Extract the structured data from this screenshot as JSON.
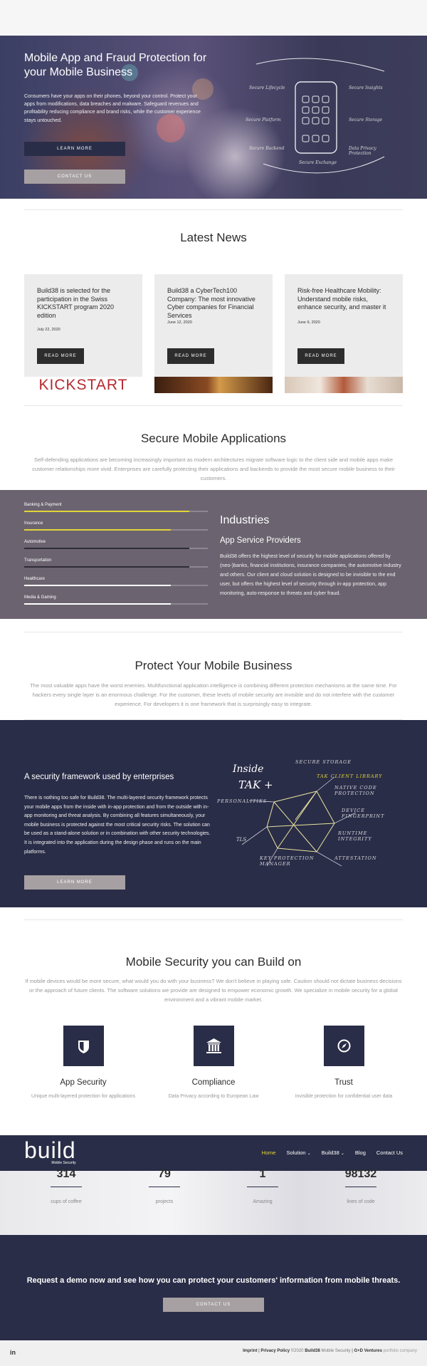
{
  "colors": {
    "navy": "#2a2d47",
    "grey_btn": "#a7a0a2",
    "purple_band": "#6b6470",
    "yellow": "#e3d43a",
    "dark_btn": "#2d2d2d"
  },
  "hero": {
    "title": "Mobile App and Fraud Protection for your Mobile Business",
    "text": "Consumers have your apps on their phones, beyond your control. Protect your apps from modifications, data breaches and malware. Safeguard revenues and profitability reducing compliance and brand risks, while the customer experience stays untouched.",
    "learn_more": "Learn More",
    "contact_us": "Contact Us",
    "sketch": [
      "Secure Lifecycle",
      "Secure Insights",
      "Secure Platform",
      "Secure Storage",
      "Secure Exchange",
      "Secure Backend",
      "Data Privacy Protection"
    ]
  },
  "news": {
    "title": "Latest News",
    "items": [
      {
        "title": "Build38 is selected for the participation in the Swiss KICKSTART program 2020 edition",
        "date": "July 22, 2020",
        "button": "Read More",
        "image_text": "KICKSTART"
      },
      {
        "title": "Build38 a CyberTech100 Company: The most innovative Cyber companies for Financial Services",
        "date": "June 12, 2020",
        "button": "Read More"
      },
      {
        "title": "Risk-free Healthcare Mobility: Understand mobile risks, enhance security, and master it",
        "date": "June 9, 2020",
        "button": "Read More"
      }
    ]
  },
  "secure_apps": {
    "title": "Secure Mobile Applications",
    "text": "Self-defending applications are becoming increasingly important as modern architectures migrate software logic to the client side and mobile apps make customer relationships more vivid. Enterprises are carefully protecting their applications and backends to provide the most secure mobile business to their customers."
  },
  "industries": {
    "title": "Industries",
    "subtitle": "App Service Providers",
    "text": "Build38 offers the highest level of security for mobile applications offered by (neo-)banks, financial institutions, insurance companies, the automotive industry and others. Our client and cloud solution is designed to be invisible to the end user, but offers the highest level of security through in-app protection, app monitoring, auto-response to threats and cyber fraud.",
    "bars": [
      {
        "label": "Banking & Payment",
        "value": 0.9,
        "color": "#e3d43a"
      },
      {
        "label": "Insurance",
        "value": 0.8,
        "color": "#e3d43a"
      },
      {
        "label": "Automotive",
        "value": 0.9,
        "color": "#2f2c37"
      },
      {
        "label": "Transportation",
        "value": 0.9,
        "color": "#2f2c37"
      },
      {
        "label": "Healthcare",
        "value": 0.8,
        "color": "#ffffff"
      },
      {
        "label": "Media & Gaming",
        "value": 0.8,
        "color": "#ffffff"
      }
    ]
  },
  "protect": {
    "title": "Protect Your Mobile Business",
    "text": "The most valuable apps have the worst enemies. Multifunctional application intelligence is combining different protection mechanisms at the same time. For hackers every single layer is an enormous challenge. For the customer, these levels of mobile security are invisible and do not interfere with the customer experience. For developers it is one framework that is surprisingly easy to integrate."
  },
  "framework": {
    "title": "A security framework used by enterprises",
    "text": "There is nothing too safe for Build38. The multi-layered security framework protects your mobile apps from the inside with in-app protection and from the outside with in-app monitoring and threat analysis. By combining all features simultaneously, your mobile business is protected against the most critical security risks. The solution can be used as a stand-alone solution or in combination with other security technologies. It is integrated into the application during the design phase and runs on the main platforms.",
    "button": "Learn More",
    "sketch": {
      "inside": "Inside",
      "tak": "TAK +",
      "labels": [
        "Secure Storage",
        "TAK Client Library",
        "Native Code Protection",
        "Device Fingerprint",
        "Runtime Integrity",
        "Attestation",
        "Key Protection Manager",
        "TLS",
        "Personalities"
      ]
    }
  },
  "build": {
    "title": "Mobile Security you can Build on",
    "text": "If mobile devices would be more secure, what would you do with your business? We don't believe in playing safe. Caution should not dictate business decisions or the approach of future clients. The software solutions we provide are designed to empower economic growth. We specialize in mobile security for a global environment and a vibrant mobile market.",
    "features": [
      {
        "icon": "shield-icon",
        "title": "App Security",
        "text": "Unique multi-layered protection for applications"
      },
      {
        "icon": "bank-icon",
        "title": "Compliance",
        "text": "Data Privacy according to European Law"
      },
      {
        "icon": "compass-icon",
        "title": "Trust",
        "text": "Invisible protection for confidential user data"
      }
    ]
  },
  "nav": {
    "logo": "build",
    "logo_sub": "Mobile Security",
    "items": [
      {
        "label": "Home",
        "active": true,
        "dropdown": false
      },
      {
        "label": "Solution",
        "active": false,
        "dropdown": true
      },
      {
        "label": "Build38",
        "active": false,
        "dropdown": true
      },
      {
        "label": "Blog",
        "active": false,
        "dropdown": false
      },
      {
        "label": "Contact Us",
        "active": false,
        "dropdown": false
      }
    ]
  },
  "stats": [
    {
      "value": "314",
      "label": "cups of coffee"
    },
    {
      "value": "79",
      "label": "projects"
    },
    {
      "value": "1",
      "label": "Amazing"
    },
    {
      "value": "98132",
      "label": "lines of code"
    }
  ],
  "cta": {
    "text": "Request a demo now and see how you can protect your customers' information from mobile threats.",
    "button": "Contact Us"
  },
  "footer": {
    "imprint": "Imprint",
    "sep": "|",
    "privacy": "Privacy Policy",
    "copyright": "©2020",
    "company": "Build38",
    "suffix": "Mobile Security",
    "sep2": "|",
    "agency": "G+D Ventures",
    "portfolio": "portfolio company",
    "social": "in"
  }
}
